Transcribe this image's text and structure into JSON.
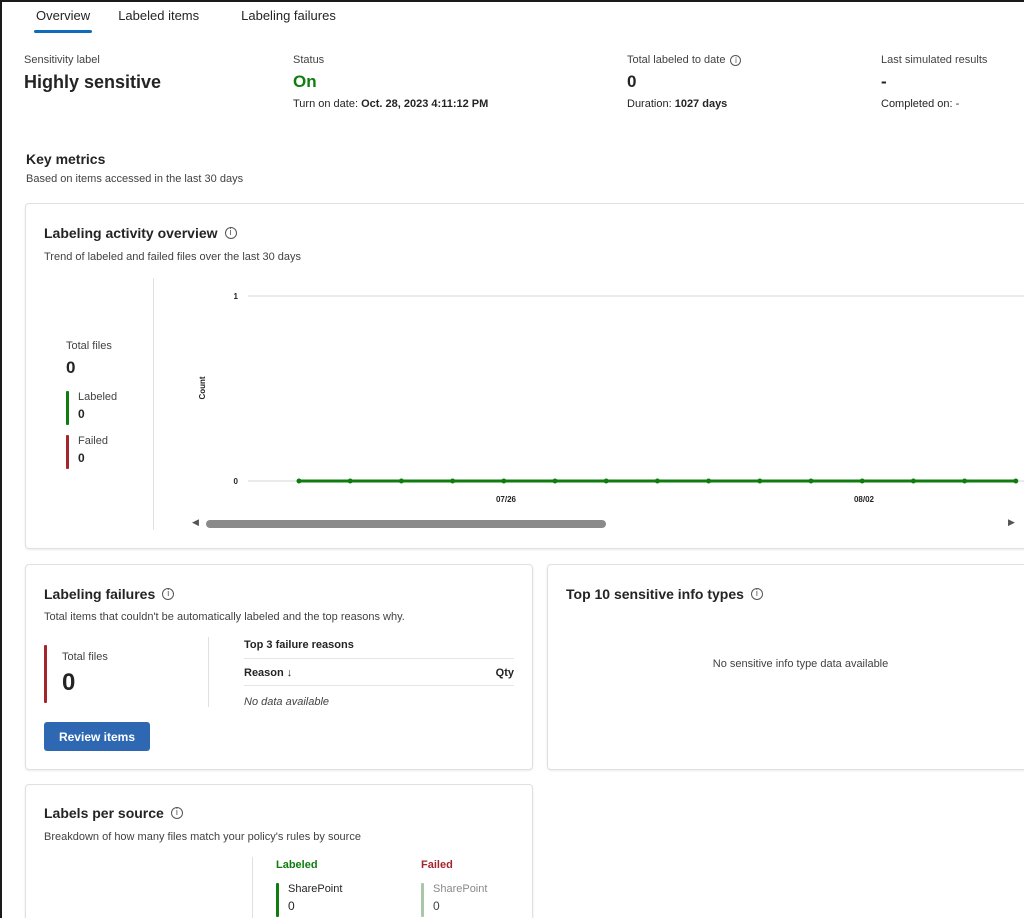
{
  "colors": {
    "accent": "#0f6cbd",
    "labeled": "#107c10",
    "failed": "#a4262c",
    "button": "#2f68b2",
    "failed_light": "#a9c7a9"
  },
  "tabs": [
    {
      "label": "Overview",
      "active": true
    },
    {
      "label": "Labeled items",
      "active": false
    },
    {
      "label": "Labeling failures",
      "active": false
    }
  ],
  "summary": {
    "sensitivity": {
      "label": "Sensitivity label",
      "value": "Highly sensitive"
    },
    "status": {
      "label": "Status",
      "value": "On",
      "turn_on_prefix": "Turn on date:",
      "turn_on_value": "Oct. 28, 2023 4:11:12 PM"
    },
    "total": {
      "label": "Total labeled to date",
      "value": "0",
      "duration_prefix": "Duration:",
      "duration_value": "1027 days"
    },
    "simulated": {
      "label": "Last simulated results",
      "value": "-",
      "completed": "Completed on: -"
    }
  },
  "key_metrics": {
    "title": "Key metrics",
    "subtitle": "Based on items accessed in the last 30 days"
  },
  "activity": {
    "title": "Labeling activity overview",
    "subtitle": "Trend of labeled and failed files over the last 30 days",
    "total_label": "Total files",
    "total_value": "0",
    "labeled_label": "Labeled",
    "labeled_value": "0",
    "failed_label": "Failed",
    "failed_value": "0"
  },
  "chart_data": {
    "type": "line",
    "title": "",
    "xlabel": "",
    "ylabel": "Count",
    "ylim": [
      0,
      1
    ],
    "y_ticks": [
      "0",
      "1"
    ],
    "x_tick_labels": [
      "07/26",
      "08/02"
    ],
    "grid": true,
    "series": [
      {
        "color": "#107c10",
        "values": [
          0,
          0,
          0,
          0,
          0,
          0,
          0,
          0,
          0,
          0,
          0,
          0,
          0,
          0,
          0
        ]
      }
    ]
  },
  "failures": {
    "title": "Labeling failures",
    "subtitle": "Total items that couldn't be automatically labeled and the top reasons why.",
    "total_label": "Total files",
    "total_value": "0",
    "reasons_header": "Top 3 failure reasons",
    "col_reason": "Reason ↓",
    "col_qty": "Qty",
    "empty": "No data available",
    "review_button": "Review items"
  },
  "top10": {
    "title": "Top 10 sensitive info types",
    "empty": "No sensitive info type data available"
  },
  "labels_per_source": {
    "title": "Labels per source",
    "subtitle": "Breakdown of how many files match your policy's rules by source",
    "labeled_head": "Labeled",
    "failed_head": "Failed",
    "labeled_items": [
      {
        "label": "SharePoint",
        "value": "0"
      }
    ],
    "failed_items": [
      {
        "label": "SharePoint",
        "value": "0"
      }
    ]
  }
}
